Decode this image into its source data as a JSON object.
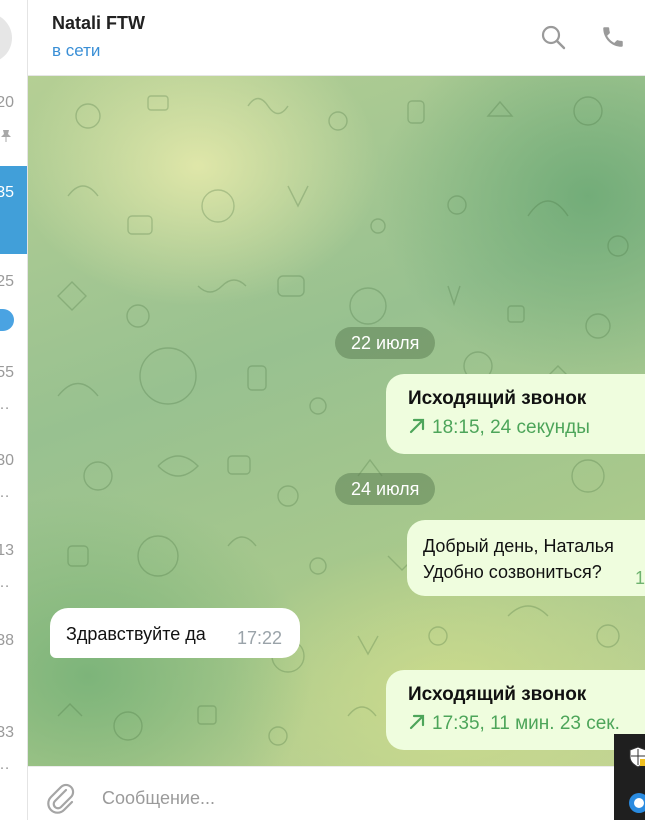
{
  "sidebar": {
    "items": [
      {
        "time": "20",
        "active": false
      },
      {
        "time": "35",
        "active": true
      },
      {
        "time": "25",
        "active": false
      },
      {
        "time": "55",
        "active": false
      },
      {
        "time": "30",
        "active": false
      },
      {
        "time": "13",
        "active": false
      },
      {
        "time": "38",
        "active": false
      },
      {
        "time": "33",
        "active": false
      }
    ],
    "ellipsis": "…"
  },
  "header": {
    "title": "Natali FTW",
    "status": "в сети",
    "search_icon": "search-icon",
    "call_icon": "phone-icon"
  },
  "messages": {
    "date1": "22 июля",
    "call1": {
      "title": "Исходящий звонок",
      "info": "18:15, 24 секунды"
    },
    "date2": "24 июля",
    "out_text": {
      "line1": "Добрый день, Наталья",
      "line2": "Удобно созвониться?",
      "time": "1"
    },
    "in_text": {
      "text": "Здравствуйте да",
      "time": "17:22"
    },
    "call2": {
      "title": "Исходящий звонок",
      "info": "17:35, 11 мин. 23 сек."
    }
  },
  "composer": {
    "placeholder": "Сообщение...",
    "attach_icon": "paperclip-icon"
  },
  "colors": {
    "accent": "#419fd9",
    "outgoing_bubble": "#effdde",
    "call_green": "#4da55a"
  }
}
